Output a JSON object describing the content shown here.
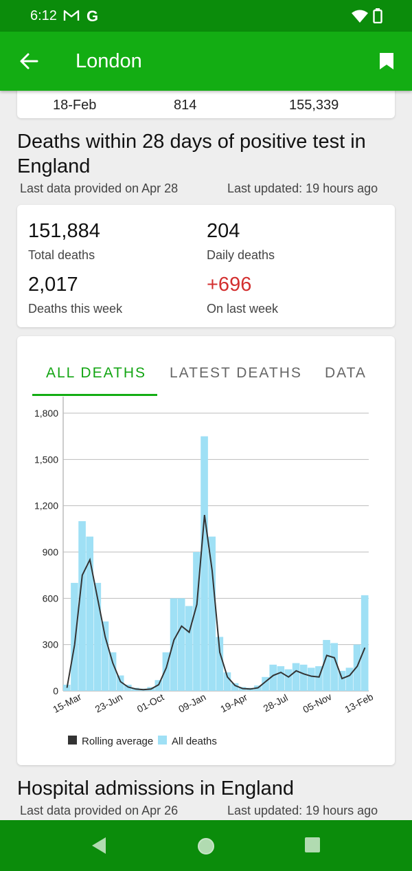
{
  "status_bar": {
    "time": "6:12",
    "g_label": "G"
  },
  "app_bar": {
    "title": "London"
  },
  "previous_row": {
    "date": "18-Feb",
    "value1": "814",
    "value2": "155,339"
  },
  "deaths_section": {
    "title": "Deaths within 28 days of positive test in England",
    "data_provided": "Last data provided on Apr 28",
    "last_updated": "Last updated: 19 hours ago",
    "stats": {
      "total_deaths_value": "151,884",
      "total_deaths_label": "Total deaths",
      "daily_deaths_value": "204",
      "daily_deaths_label": "Daily deaths",
      "week_deaths_value": "2,017",
      "week_deaths_label": "Deaths this week",
      "change_value": "+696",
      "change_label": "On last week"
    },
    "tabs": [
      "ALL DEATHS",
      "LATEST DEATHS",
      "DATA"
    ]
  },
  "chart_data": {
    "type": "bar",
    "ylim": [
      0,
      1800
    ],
    "y_ticks": [
      "0",
      "300",
      "600",
      "900",
      "1,200",
      "1,500",
      "1,800"
    ],
    "x_tick_labels": [
      "15-Mar",
      "23-Jun",
      "01-Oct",
      "09-Jan",
      "19-Apr",
      "28-Jul",
      "05-Nov",
      "13-Feb"
    ],
    "legend": [
      "Rolling average",
      "All deaths"
    ],
    "series": [
      {
        "name": "Rolling average",
        "color": "#333333",
        "values": [
          20,
          300,
          750,
          850,
          600,
          350,
          180,
          60,
          25,
          12,
          8,
          12,
          40,
          150,
          330,
          420,
          380,
          560,
          1140,
          780,
          250,
          90,
          35,
          15,
          12,
          20,
          60,
          100,
          120,
          90,
          130,
          110,
          95,
          90,
          230,
          215,
          80,
          100,
          160,
          280
        ]
      },
      {
        "name": "All deaths",
        "color": "#9fe0f5",
        "values": [
          40,
          700,
          1100,
          1000,
          700,
          450,
          250,
          100,
          40,
          20,
          15,
          25,
          70,
          250,
          600,
          600,
          550,
          900,
          1650,
          1000,
          350,
          120,
          50,
          25,
          20,
          35,
          90,
          170,
          160,
          140,
          180,
          170,
          150,
          160,
          330,
          310,
          130,
          150,
          300,
          620
        ]
      }
    ]
  },
  "hospital_section": {
    "title": "Hospital admissions in England",
    "data_provided": "Last data provided on Apr 26",
    "last_updated": "Last updated: 19 hours ago"
  },
  "colors": {
    "status_bar": "#0b8c0b",
    "app_bar": "#13ad13",
    "accent": "#13a513",
    "negative": "#d32f2f"
  }
}
